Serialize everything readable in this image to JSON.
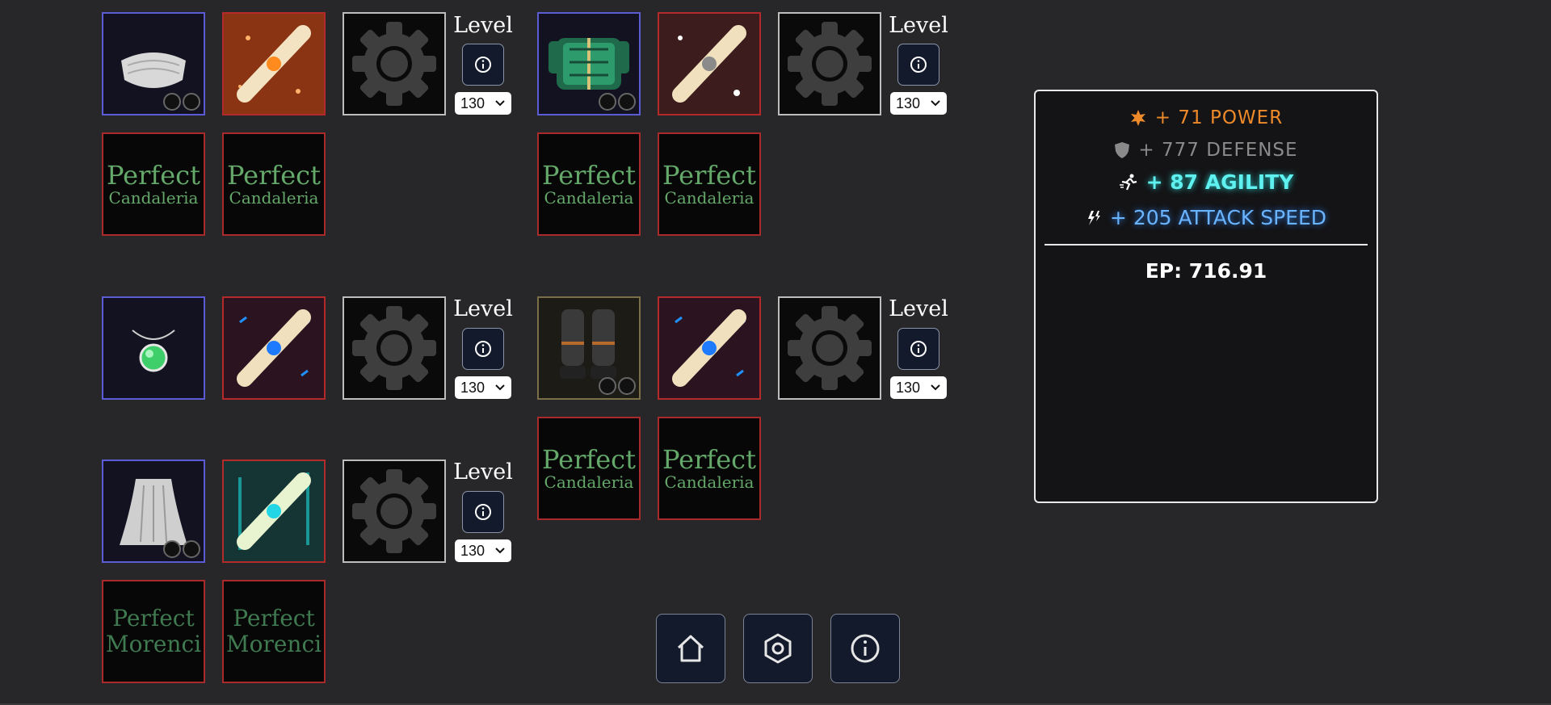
{
  "rows": [
    {
      "name": "headgear",
      "item": "white-mask",
      "item_border": "#5c5bd6",
      "scroll": "orange-scroll",
      "level_label": "Level",
      "level_value": "130",
      "crystals": [
        {
          "line1": "Perfect",
          "line2": "Candaleria"
        },
        {
          "line1": "Perfect",
          "line2": "Candaleria"
        }
      ]
    },
    {
      "name": "armor",
      "item": "green-armor",
      "scroll": "white-scroll",
      "level_label": "Level",
      "level_value": "130",
      "crystals": [
        {
          "line1": "Perfect",
          "line2": "Candaleria"
        },
        {
          "line1": "Perfect",
          "line2": "Candaleria"
        }
      ]
    },
    {
      "name": "necklace",
      "item": "green-pendant",
      "scroll": "blue-scroll",
      "level_label": "Level",
      "level_value": "130"
    },
    {
      "name": "boots",
      "item": "dark-boots",
      "scroll": "blue-scroll",
      "level_label": "Level",
      "level_value": "130",
      "crystals": [
        {
          "line1": "Perfect",
          "line2": "Candaleria"
        },
        {
          "line1": "Perfect",
          "line2": "Candaleria"
        }
      ]
    },
    {
      "name": "cloak",
      "item": "white-cloak",
      "scroll": "cyan-scroll",
      "level_label": "Level",
      "level_value": "130",
      "crystals": [
        {
          "line1": "Perfect",
          "line2": "Morenci"
        },
        {
          "line1": "Perfect",
          "line2": "Morenci"
        }
      ]
    }
  ],
  "stats": {
    "power": "+ 71 POWER",
    "defense": "+ 777 DEFENSE",
    "agility": "+ 87 AGILITY",
    "attack_speed": "+ 205 ATTACK SPEED",
    "ep": "EP: 716.91"
  },
  "nav": {
    "home": "home-icon",
    "settings": "hexagon-settings-icon",
    "info": "info-icon"
  },
  "colors": {
    "background": "#272729",
    "power": "#ee8a2a",
    "defense": "#8a8a8a",
    "agility": "#5ff0f0",
    "attack_speed": "#6ab4ff",
    "crystal_text": "#64a86a",
    "item_border": "#5c5bd6",
    "scroll_border": "#b42a2a"
  }
}
